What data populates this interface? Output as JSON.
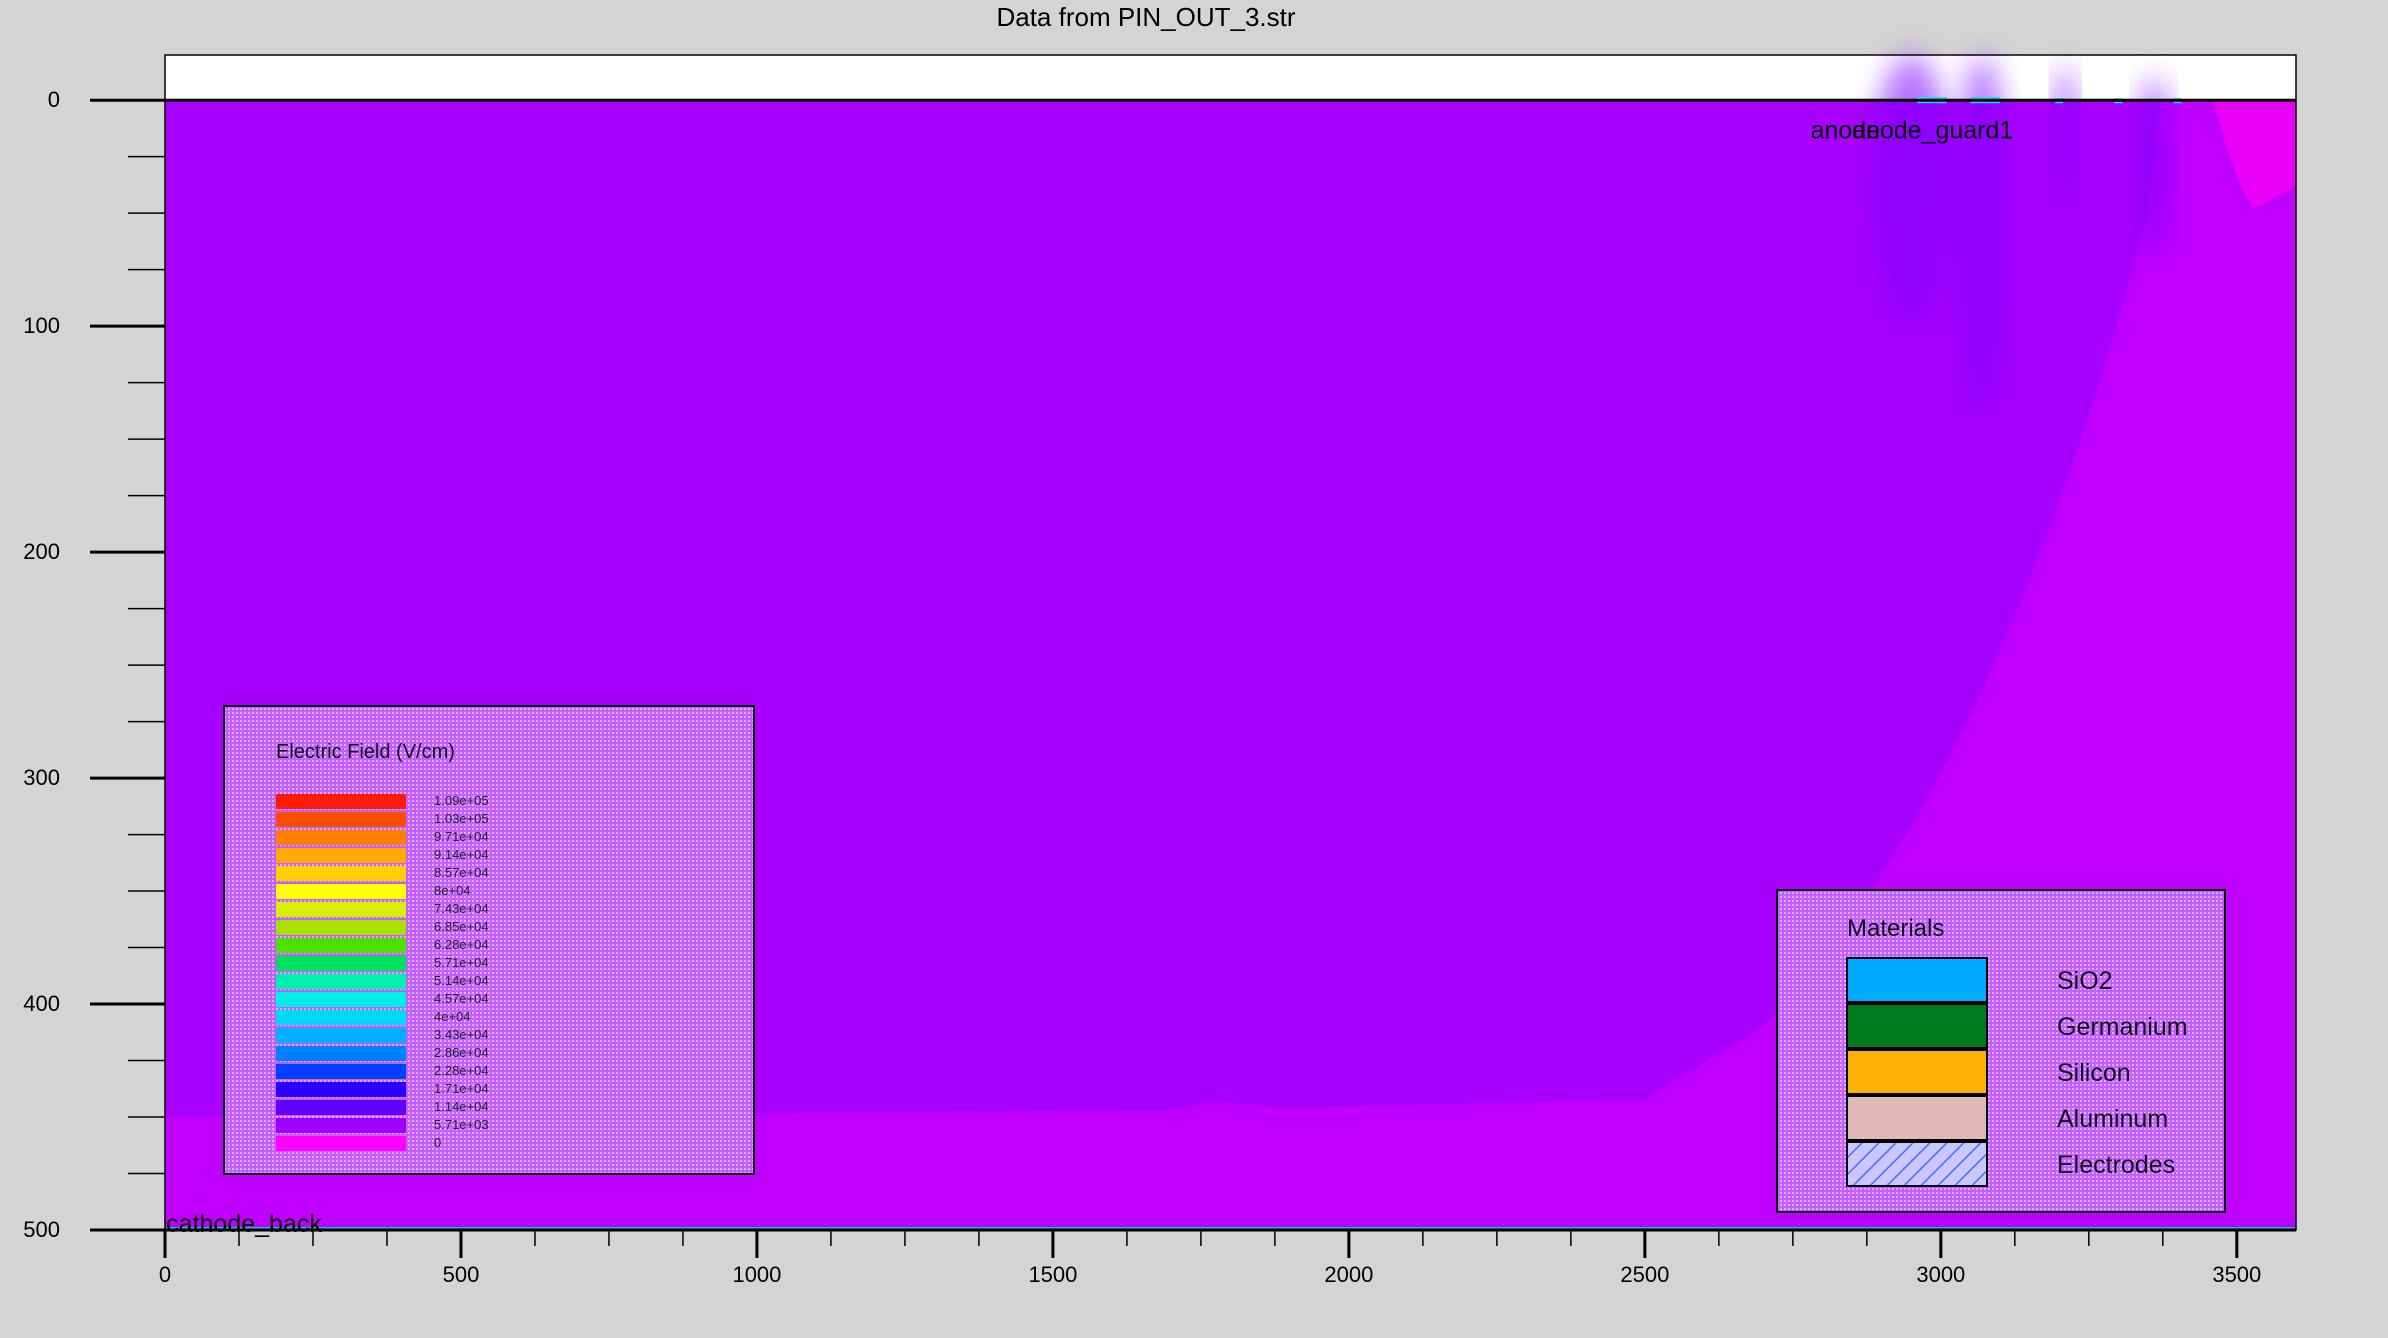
{
  "chart_data": {
    "type": "heatmap",
    "title": "Data from PIN_OUT_3.str",
    "xlabel": "",
    "ylabel": "",
    "xlim": [
      0,
      3600
    ],
    "ylim": [
      500,
      -20
    ],
    "x_ticks": [
      0,
      500,
      1000,
      1500,
      2000,
      2500,
      3000,
      3500
    ],
    "y_ticks": [
      0,
      100,
      200,
      300,
      400,
      500
    ],
    "x_minor_step": 125,
    "y_minor_step": 25,
    "electrode_labels": [
      {
        "text": "anode",
        "x": 2780,
        "y": 13
      },
      {
        "text": "anode_guard1",
        "x": 2850,
        "y": 13
      },
      {
        "text": "cathode_back",
        "x": 2,
        "y": 497
      }
    ],
    "field_legend": {
      "title": "Electric Field (V/cm)",
      "levels": [
        "1.09e+05",
        "1.03e+05",
        "9.71e+04",
        "9.14e+04",
        "8.57e+04",
        "8e+04",
        "7.43e+04",
        "6.85e+04",
        "6.28e+04",
        "5.71e+04",
        "5.14e+04",
        "4.57e+04",
        "4e+04",
        "3.43e+04",
        "2.86e+04",
        "2.28e+04",
        "1.71e+04",
        "1.14e+04",
        "5.71e+03",
        "0"
      ],
      "colors": [
        "#ff1a00",
        "#ff4d00",
        "#ff8000",
        "#ffaa00",
        "#ffd000",
        "#ffff00",
        "#d8f000",
        "#a8e000",
        "#50e000",
        "#00e060",
        "#00f0b0",
        "#00f0e8",
        "#00d8f8",
        "#00b0ff",
        "#0080ff",
        "#0040ff",
        "#2a00ff",
        "#6000ff",
        "#a000ff",
        "#ff00ff"
      ]
    },
    "materials_legend": {
      "title": "Materials",
      "items": [
        {
          "name": "SiO2",
          "color": "#00aaff"
        },
        {
          "name": "Germanium",
          "color": "#007a1e"
        },
        {
          "name": "Silicon",
          "color": "#ffb000"
        },
        {
          "name": "Aluminum",
          "color": "#e0b8b8"
        },
        {
          "name": "Electrodes",
          "color": "#c8c8ff"
        }
      ]
    },
    "colors": {
      "background": "#d4d4d4",
      "bulk_field": "#a800ff",
      "low_field": "#c000ff",
      "high_field": "#e800f8",
      "air": "#ffffff"
    }
  }
}
